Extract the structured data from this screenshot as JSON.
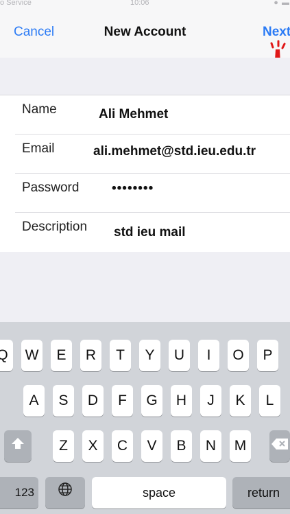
{
  "status_bar": {
    "carrier": "o Service",
    "time": "10:06"
  },
  "nav": {
    "cancel_label": "Cancel",
    "title": "New Account",
    "next_label": "Next",
    "accent_color": "#2b7bf5"
  },
  "form": {
    "fields": [
      {
        "label": "Name",
        "value": "Ali Mehmet"
      },
      {
        "label": "Email",
        "value": "ali.mehmet@std.ieu.edu.tr"
      },
      {
        "label": "Password",
        "value": "••••••••"
      },
      {
        "label": "Description",
        "value": "std ieu mail"
      }
    ]
  },
  "keyboard": {
    "row1": [
      "Q",
      "W",
      "E",
      "R",
      "T",
      "Y",
      "U",
      "I",
      "O",
      "P"
    ],
    "row2": [
      "A",
      "S",
      "D",
      "F",
      "G",
      "H",
      "J",
      "K",
      "L"
    ],
    "row3": [
      "Z",
      "X",
      "C",
      "V",
      "B",
      "N",
      "M"
    ],
    "numbers_label": "123",
    "space_label": "space",
    "return_label": "return",
    "icons": [
      "shift-icon",
      "backspace-icon",
      "globe-icon"
    ]
  }
}
